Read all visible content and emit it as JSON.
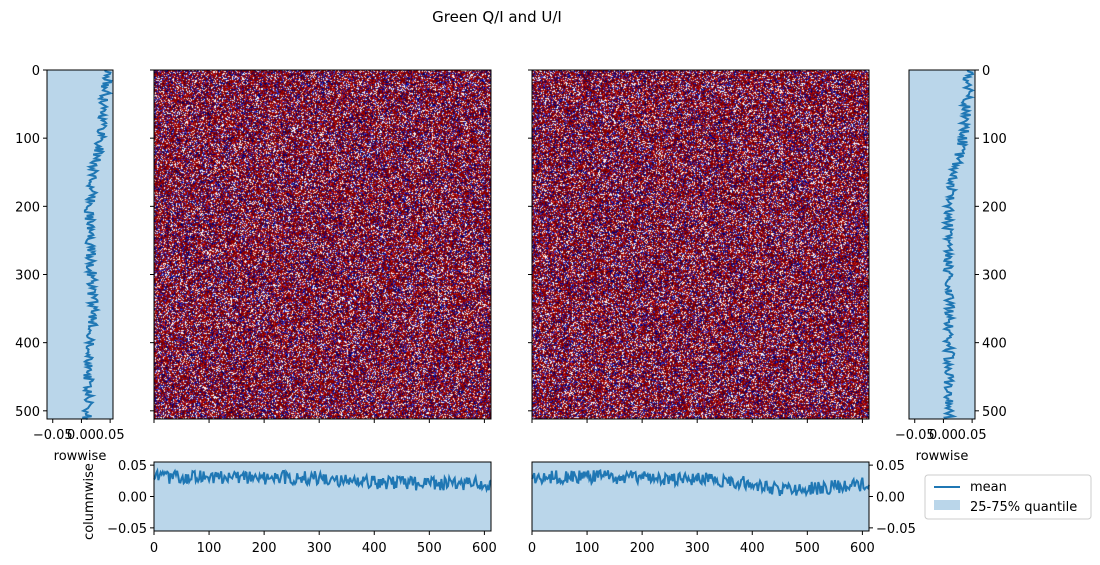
{
  "figure": {
    "title": "Green Q/I and U/I"
  },
  "colors": {
    "mean_line": "#1f77b4",
    "quantile_fill": "#bad6ea",
    "map_red": "#8b0000",
    "map_blue": "#00007a",
    "map_white": "#ffffff"
  },
  "chart_data": [
    {
      "id": "rowwise_Q",
      "type": "line",
      "orientation": "vertical",
      "xlabel": "rowwise",
      "xlim": [
        -0.06,
        0.055
      ],
      "xticks": [
        "−0.05",
        "0.00",
        "0.05"
      ],
      "ylim": [
        512,
        0
      ],
      "yticks": [
        "0",
        "100",
        "200",
        "300",
        "400",
        "500"
      ],
      "mean_profile": {
        "rows": [
          0,
          50,
          100,
          150,
          200,
          250,
          300,
          350,
          400,
          450,
          500,
          512
        ],
        "values": [
          0.045,
          0.04,
          0.035,
          0.02,
          0.015,
          0.015,
          0.018,
          0.02,
          0.018,
          0.012,
          0.01,
          0.01
        ]
      },
      "noise_amplitude": 0.009,
      "quantile_25_75": [
        -0.06,
        0.055
      ]
    },
    {
      "id": "map_Q",
      "type": "heatmap",
      "xticks": [
        "0",
        "100",
        "200",
        "300",
        "400",
        "500",
        "600"
      ],
      "yticks": [
        "0",
        "100",
        "200",
        "300",
        "400",
        "500"
      ],
      "xlim": [
        0,
        612
      ],
      "ylim": [
        512,
        0
      ],
      "palette": "seismic"
    },
    {
      "id": "map_U",
      "type": "heatmap",
      "xticks": [
        "0",
        "100",
        "200",
        "300",
        "400",
        "500",
        "600"
      ],
      "yticks": [
        "0",
        "100",
        "200",
        "300",
        "400",
        "500"
      ],
      "xlim": [
        0,
        612
      ],
      "ylim": [
        512,
        0
      ],
      "palette": "seismic"
    },
    {
      "id": "rowwise_U",
      "type": "line",
      "orientation": "vertical",
      "xlabel": "rowwise",
      "xlim": [
        -0.06,
        0.055
      ],
      "xticks": [
        "−0.05",
        "0.00",
        "0.05"
      ],
      "ylim": [
        512,
        0
      ],
      "yticks": [
        "0",
        "100",
        "200",
        "300",
        "400",
        "500"
      ],
      "mean_profile": {
        "rows": [
          0,
          50,
          100,
          150,
          200,
          250,
          300,
          350,
          400,
          450,
          500,
          512
        ],
        "values": [
          0.045,
          0.04,
          0.035,
          0.02,
          0.01,
          0.008,
          0.01,
          0.012,
          0.01,
          0.01,
          0.01,
          0.01
        ]
      },
      "noise_amplitude": 0.009,
      "quantile_25_75": [
        -0.06,
        0.055
      ]
    },
    {
      "id": "columnwise_Q",
      "type": "line",
      "ylabel": "columnwise",
      "xlim": [
        0,
        612
      ],
      "xticks": [
        "0",
        "100",
        "200",
        "300",
        "400",
        "500",
        "600"
      ],
      "ylim": [
        -0.055,
        0.055
      ],
      "yticks": [
        "0.05",
        "0.00",
        "−0.05"
      ],
      "mean_profile": {
        "cols": [
          0,
          100,
          200,
          300,
          400,
          500,
          612
        ],
        "values": [
          0.03,
          0.032,
          0.03,
          0.03,
          0.022,
          0.02,
          0.02
        ]
      },
      "noise_amplitude": 0.011,
      "quantile_25_75": [
        -0.055,
        0.055
      ]
    },
    {
      "id": "columnwise_U",
      "type": "line",
      "xlim": [
        0,
        612
      ],
      "xticks": [
        "0",
        "100",
        "200",
        "300",
        "400",
        "500",
        "600"
      ],
      "ylim": [
        -0.055,
        0.055
      ],
      "yticks": [
        "0.05",
        "0.00",
        "−0.05"
      ],
      "mean_profile": {
        "cols": [
          0,
          100,
          200,
          300,
          380,
          450,
          500,
          612
        ],
        "values": [
          0.03,
          0.032,
          0.03,
          0.028,
          0.022,
          0.012,
          0.012,
          0.02
        ]
      },
      "noise_amplitude": 0.011,
      "quantile_25_75": [
        -0.055,
        0.055
      ]
    }
  ],
  "legend": {
    "placement": "right",
    "items": [
      {
        "label": "mean",
        "kind": "line"
      },
      {
        "label": "25-75% quantile",
        "kind": "patch"
      }
    ]
  }
}
